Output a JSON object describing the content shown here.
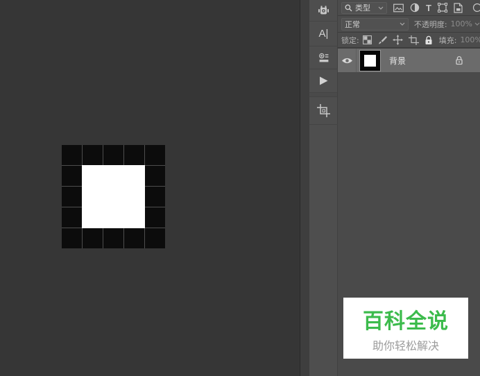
{
  "canvas": {
    "background": "#363636",
    "pixel_art": {
      "rows": [
        "BBBBB",
        "BWWWB",
        "BWWWB",
        "BWWWB",
        "BBBBB"
      ],
      "black_color": "#0c0c0c",
      "white_color": "#ffffff",
      "gridline_color": "#4e4e4e"
    }
  },
  "dock": {
    "items": [
      {
        "icon": "robot-icon"
      },
      {
        "icon": "character-panel-icon",
        "text": "A|"
      },
      {
        "icon": "libraries-icon"
      },
      {
        "icon": "play-icon"
      },
      {
        "icon": "crop-icon"
      }
    ]
  },
  "layers_panel": {
    "filter_row": {
      "kind_label": "类型",
      "type_filter_char": "T"
    },
    "blend_row": {
      "blend_mode": "正常",
      "opacity_label": "不透明度:",
      "opacity_value": "100%"
    },
    "lock_row": {
      "lock_label": "锁定:",
      "fill_label": "填充:",
      "fill_value": "100%"
    },
    "layers": [
      {
        "name": "背景",
        "visible": true,
        "locked": true
      }
    ]
  },
  "watermark": {
    "title": "百科全说",
    "subtitle": "助你轻松解决",
    "title_color": "#3cbb4c",
    "subtitle_color": "#9c9c9c",
    "background": "#ffffff"
  }
}
